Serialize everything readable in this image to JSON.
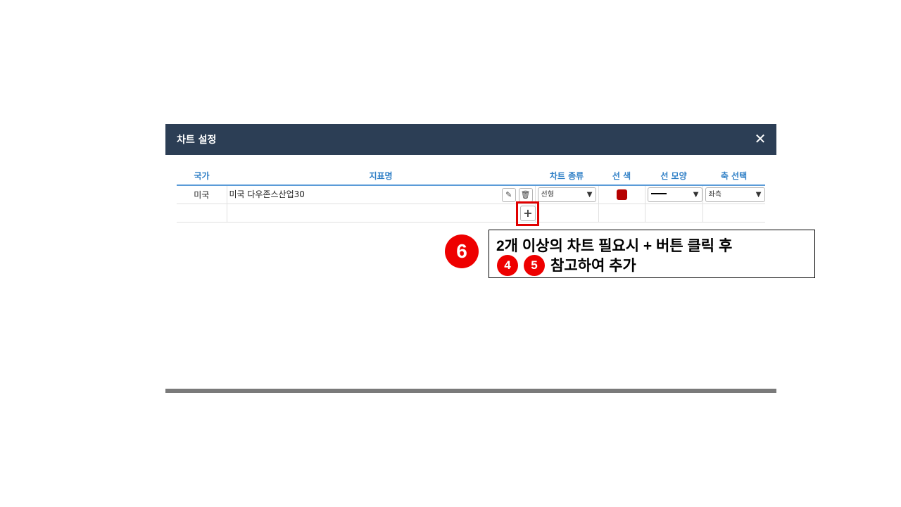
{
  "dialog": {
    "title": "차트 설정",
    "close_label": "✕"
  },
  "table": {
    "headers": {
      "country": "국가",
      "indicator": "지표명",
      "chart_type": "차트 종류",
      "line_color": "선 색",
      "line_shape": "선 모양",
      "axis": "축 선택"
    },
    "rows": [
      {
        "country": "미국",
        "indicator": "미국 다우존스산업30",
        "chart_type": "선형",
        "line_color": "#b50000",
        "line_shape": "solid",
        "axis": "좌측"
      }
    ]
  },
  "icons": {
    "edit": "pencil-icon",
    "delete": "trash-icon",
    "add": "plus-icon"
  },
  "add_button_label": "+",
  "annotation": {
    "step6": "6",
    "step4": "4",
    "step5": "5",
    "line1": "2개 이상의 차트 필요시 + 버튼 클릭 후",
    "line2": "참고하여 추가",
    "highlight_color": "#e00000"
  }
}
